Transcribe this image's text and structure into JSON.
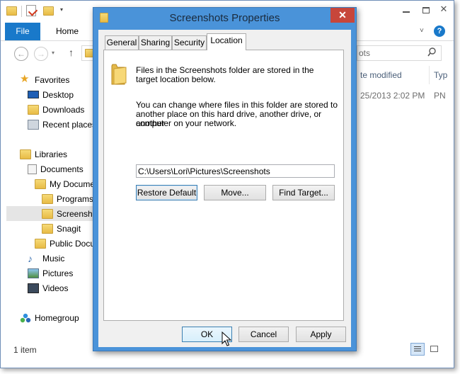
{
  "explorer": {
    "ribbon": {
      "file_label": "File",
      "home_label": "Home"
    },
    "search_placeholder_fragment": "ots",
    "columns": {
      "date_modified_fragment": "te modified",
      "type_fragment": "Typ"
    },
    "file_row": {
      "date_fragment": "25/2013 2:02 PM",
      "type_fragment": "PN"
    },
    "nav": {
      "favorites": "Favorites",
      "desktop": "Desktop",
      "downloads": "Downloads",
      "recent_places": "Recent places",
      "libraries": "Libraries",
      "documents": "Documents",
      "my_documents": "My Docume",
      "programs": "Programs",
      "screenshots": "Screenshots",
      "snagit": "Snagit",
      "public_documents": "Public Docu",
      "music": "Music",
      "pictures": "Pictures",
      "videos": "Videos",
      "homegroup": "Homegroup"
    },
    "status": {
      "item_count": "1 item"
    }
  },
  "dialog": {
    "title": "Screenshots Properties",
    "close_glyph": "✕",
    "tabs": [
      "General",
      "Sharing",
      "Security",
      "Location"
    ],
    "active_tab": "Location",
    "info_line1": "Files in the Screenshots folder are stored in the",
    "info_line2": "target location below.",
    "desc_line1": "You can change where files in this folder are stored to",
    "desc_line2": "another place on this hard drive, another drive, or another",
    "desc_line3": "computer on your network.",
    "path_value": "C:\\Users\\Lori\\Pictures\\Screenshots",
    "buttons": {
      "restore_default": "Restore Default",
      "move": "Move...",
      "find_target": "Find Target...",
      "ok": "OK",
      "cancel": "Cancel",
      "apply": "Apply"
    }
  }
}
